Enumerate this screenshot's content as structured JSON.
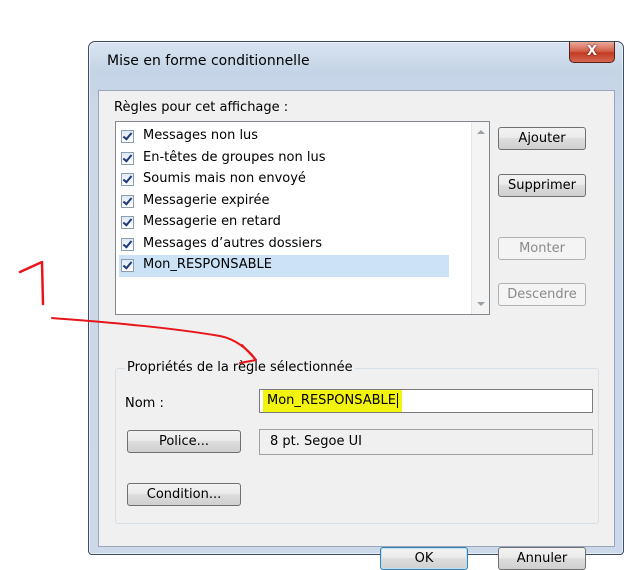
{
  "window": {
    "title": "Mise en forme conditionnelle",
    "close_glyph": "X"
  },
  "rules": {
    "label": "Règles pour cet affichage :",
    "items": [
      {
        "label": "Messages non lus",
        "checked": true,
        "selected": false
      },
      {
        "label": "En-têtes de groupes non lus",
        "checked": true,
        "selected": false
      },
      {
        "label": "Soumis mais non envoyé",
        "checked": true,
        "selected": false
      },
      {
        "label": "Messagerie expirée",
        "checked": true,
        "selected": false
      },
      {
        "label": "Messagerie en retard",
        "checked": true,
        "selected": false
      },
      {
        "label": "Messages d’autres dossiers",
        "checked": true,
        "selected": false
      },
      {
        "label": "Mon_RESPONSABLE",
        "checked": true,
        "selected": true
      }
    ]
  },
  "buttons": {
    "add": "Ajouter",
    "delete": "Supprimer",
    "up": "Monter",
    "down": "Descendre",
    "font": "Police...",
    "condition": "Condition...",
    "ok": "OK",
    "cancel": "Annuler"
  },
  "properties": {
    "group_label": "Propriétés de la règle sélectionnée",
    "name_label": "Nom :",
    "name_value": "Mon_RESPONSABLE",
    "font_value": "8 pt. Segoe UI"
  },
  "annotation": {
    "number": "1",
    "color": "#e8161a",
    "highlight_color": "#f3f310"
  }
}
